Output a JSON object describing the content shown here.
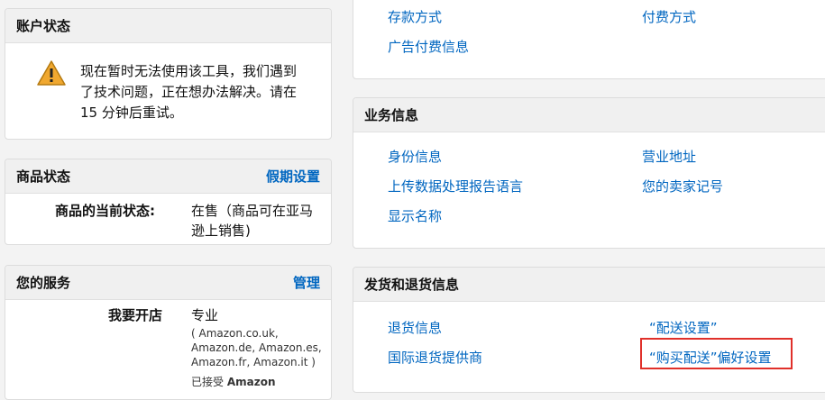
{
  "account_status": {
    "title": "账户状态",
    "warning_lines": [
      "现在暂时无法使用该工具，我们遇到",
      "了技术问题，正在想办法解决。请在",
      "15 分钟后重试。"
    ]
  },
  "product_status": {
    "title": "商品状态",
    "action_label": "假期设置",
    "field_label": "商品的当前状态:",
    "value_lines": [
      "在售（商品可在亚马",
      "逊上销售)"
    ]
  },
  "your_services": {
    "title": "您的服务",
    "action_label": "管理",
    "field_label": "我要开店",
    "plan": "专业",
    "sites_lines": [
      "( Amazon.co.uk,",
      "Amazon.de, Amazon.es,",
      "Amazon.fr, Amazon.it )"
    ],
    "accepted_prefix": "已接受",
    "accepted_bold": "Amazon"
  },
  "payment_info": {
    "links_left": [
      "存款方式",
      "广告付费信息"
    ],
    "links_right": [
      "付费方式"
    ]
  },
  "business_info": {
    "title": "业务信息",
    "links_left": [
      "身份信息",
      "上传数据处理报告语言",
      "显示名称"
    ],
    "links_right": [
      "营业地址",
      "您的卖家记号"
    ]
  },
  "shipping_returns": {
    "title": "发货和退货信息",
    "links_left": [
      "退货信息",
      "国际退货提供商"
    ],
    "links_right": [
      "“配送设置”",
      "“购买配送”偏好设置"
    ]
  },
  "colors": {
    "link": "#0066c0",
    "highlight": "#e0302a",
    "warning": "#f0a830"
  }
}
